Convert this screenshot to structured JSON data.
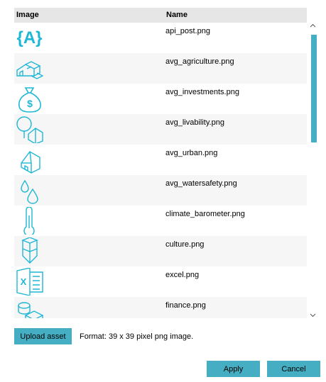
{
  "table": {
    "col_image": "Image",
    "col_name": "Name",
    "rows": [
      {
        "icon": "api-braces-icon",
        "name": "api_post.png"
      },
      {
        "icon": "agriculture-barn-icon",
        "name": "avg_agriculture.png"
      },
      {
        "icon": "money-bag-icon",
        "name": "avg_investments.png"
      },
      {
        "icon": "tree-house-icon",
        "name": "avg_livability.png"
      },
      {
        "icon": "urban-house-icon",
        "name": "avg_urban.png"
      },
      {
        "icon": "water-drops-icon",
        "name": "avg_watersafety.png"
      },
      {
        "icon": "thermometer-icon",
        "name": "climate_barometer.png"
      },
      {
        "icon": "culture-jar-icon",
        "name": "culture.png"
      },
      {
        "icon": "excel-icon",
        "name": "excel.png"
      },
      {
        "icon": "coins-icon",
        "name": "finance.png"
      }
    ]
  },
  "upload": {
    "label": "Upload asset"
  },
  "format_text": "Format: 39 x 39 pixel png image.",
  "actions": {
    "apply": "Apply",
    "cancel": "Cancel"
  },
  "colors": {
    "accent": "#45aec3",
    "icon": "#1fb7d6",
    "header_bg": "#e6e6e6"
  }
}
